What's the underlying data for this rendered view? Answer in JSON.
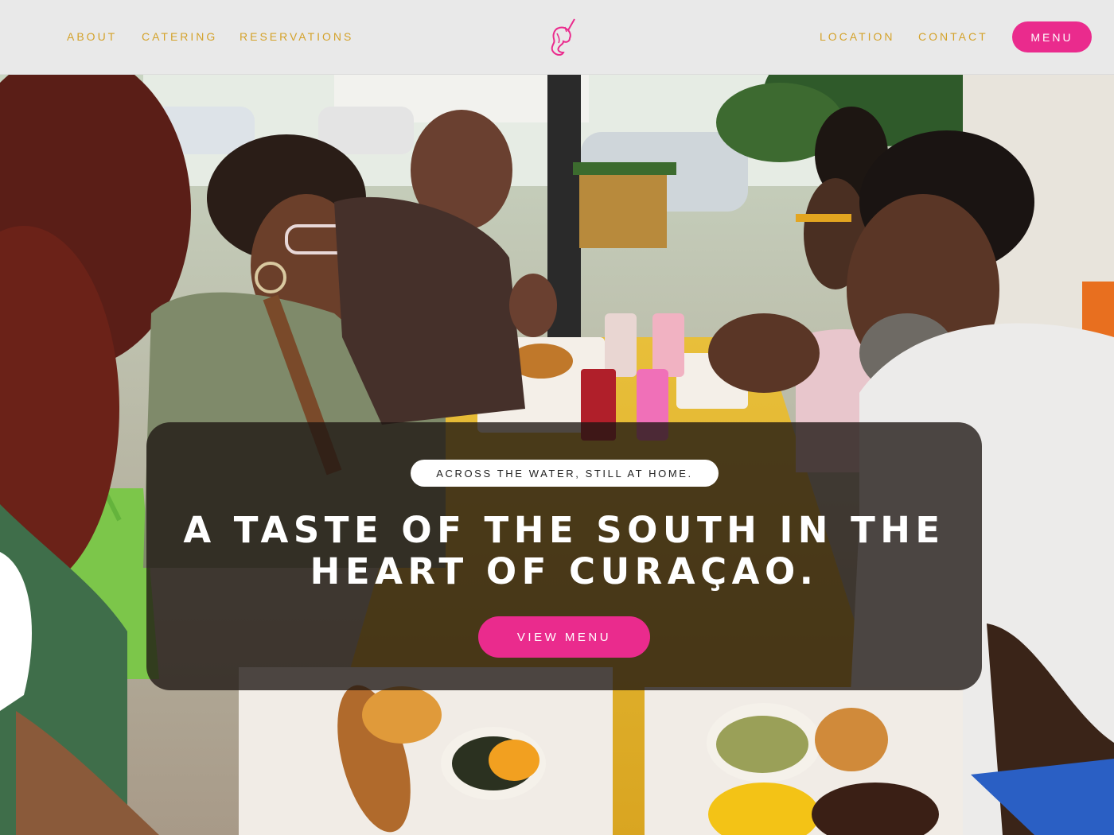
{
  "header": {
    "nav_left": [
      "ABOUT",
      "CATERING",
      "RESERVATIONS"
    ],
    "nav_right": [
      "LOCATION",
      "CONTACT"
    ],
    "menu_button": "MENU",
    "logo_icon": "unicorn-logo-icon"
  },
  "hero": {
    "tagline": "ACROSS THE WATER, STILL AT HOME.",
    "headline_line1": "A TASTE OF THE SOUTH IN THE",
    "headline_line2": "HEART OF CURAÇAO.",
    "cta": "VIEW MENU",
    "image": "hero-photo-diners-at-table"
  },
  "colors": {
    "accent_pink": "#ea2b8d",
    "nav_gold": "#d4a22a",
    "header_bg": "#e9e9e9",
    "panel_bg": "rgba(30,22,18,0.78)"
  }
}
